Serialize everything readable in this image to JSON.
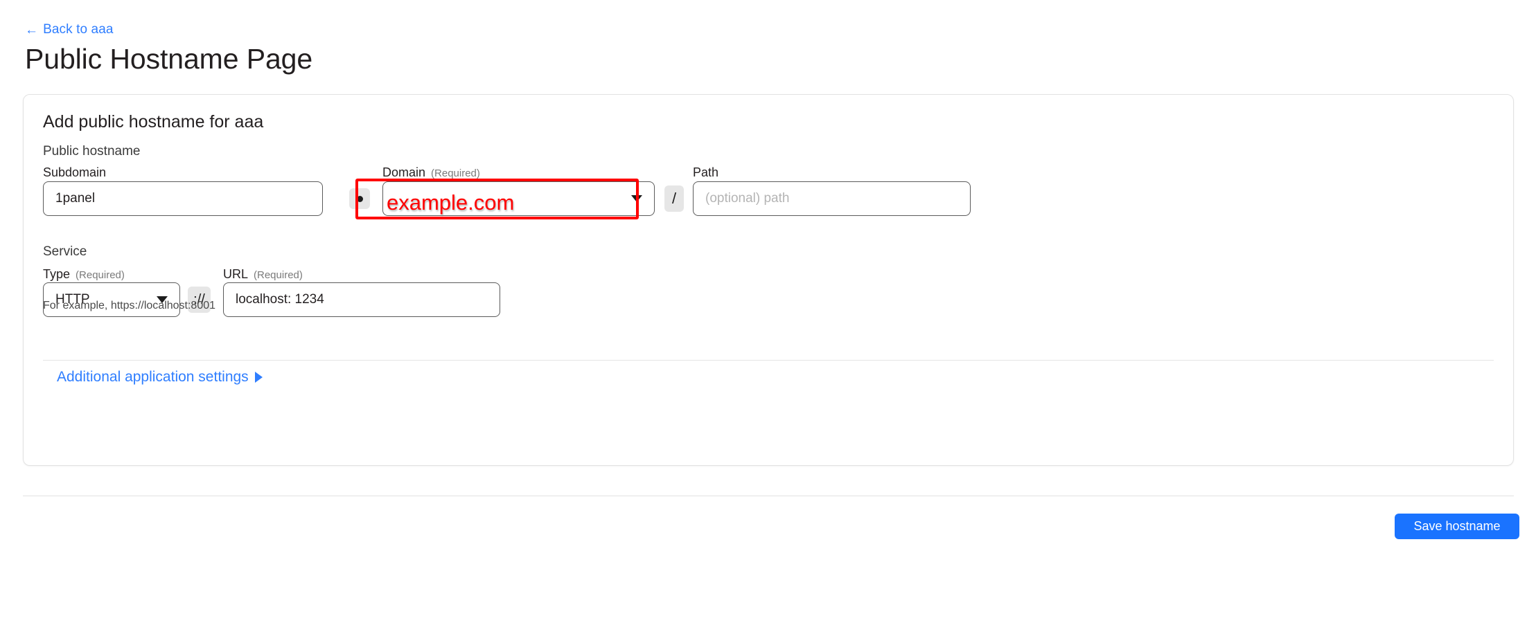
{
  "header": {
    "back_link": "Back to aaa",
    "back_arrow_icon": "arrow-left-icon",
    "title": "Public Hostname Page"
  },
  "card": {
    "title": "Add public hostname for aaa",
    "hostname_section_label": "Public hostname",
    "service_section_label": "Service",
    "fields": {
      "subdomain": {
        "label": "Subdomain",
        "value": "1panel",
        "placeholder": ""
      },
      "domain": {
        "label": "Domain",
        "required_tag": "(Required)",
        "value": "example.com",
        "caret_icon": "chevron-down-icon"
      },
      "path": {
        "label": "Path",
        "value": "",
        "placeholder": "(optional) path"
      },
      "type": {
        "label": "Type",
        "required_tag": "(Required)",
        "value": "HTTP",
        "caret_icon": "chevron-down-icon"
      },
      "url": {
        "label": "URL",
        "required_tag": "(Required)",
        "value": "localhost: 1234",
        "placeholder": ""
      }
    },
    "separators": {
      "dot": ".",
      "slash": "/",
      "protocol": "://"
    },
    "helper_text": "For example, https://localhost:8001",
    "additional_settings_link": "Additional application settings",
    "additional_settings_icon": "triangle-right-icon"
  },
  "footer": {
    "save_button": "Save hostname"
  },
  "annotation": {
    "highlight_color": "#ff0000",
    "overlay_text": "example.com"
  },
  "colors": {
    "link_blue": "#2f7eff",
    "button_blue": "#1a73ff",
    "text": "#231f20",
    "border": "#5a5a5a",
    "highlight_red": "#ff0000"
  }
}
